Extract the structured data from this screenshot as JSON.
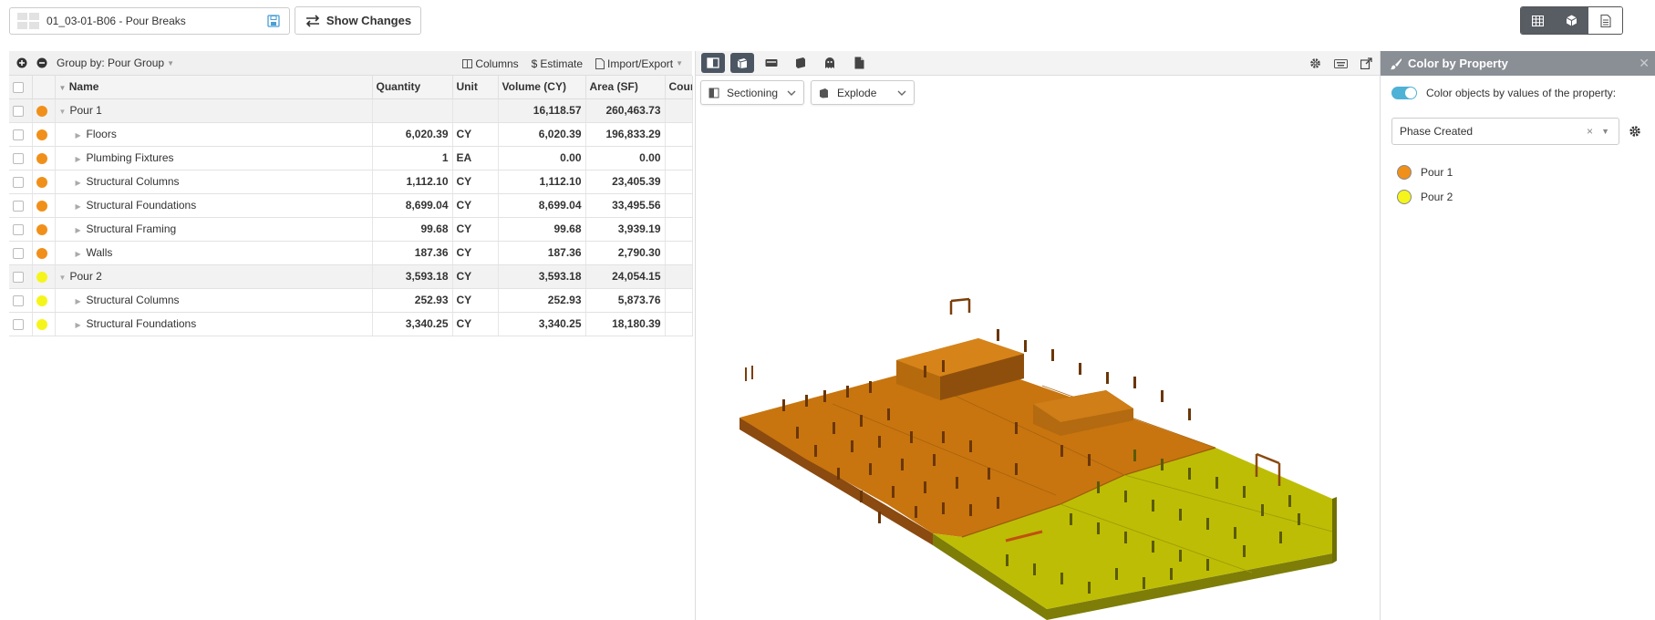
{
  "header": {
    "title": "01_03-01-B06 - Pour Breaks",
    "show_changes_label": "Show Changes"
  },
  "grid": {
    "toolbar": {
      "group_by_label": "Group by: Pour Group",
      "columns_label": "Columns",
      "estimate_label": "Estimate",
      "import_export_label": "Import/Export"
    },
    "columns": [
      "Name",
      "Quantity",
      "Unit",
      "Volume (CY)",
      "Area (SF)",
      "Cour"
    ],
    "rows": [
      {
        "type": "group",
        "color": "#f0901a",
        "name": "Pour 1",
        "quantity": "",
        "unit": "",
        "volume": "16,118.57",
        "area": "260,463.73"
      },
      {
        "type": "item",
        "color": "#f0901a",
        "name": "Floors",
        "quantity": "6,020.39",
        "unit": "CY",
        "volume": "6,020.39",
        "area": "196,833.29"
      },
      {
        "type": "item",
        "color": "#f0901a",
        "name": "Plumbing Fixtures",
        "quantity": "1",
        "unit": "EA",
        "volume": "0.00",
        "area": "0.00"
      },
      {
        "type": "item",
        "color": "#f0901a",
        "name": "Structural Columns",
        "quantity": "1,112.10",
        "unit": "CY",
        "volume": "1,112.10",
        "area": "23,405.39"
      },
      {
        "type": "item",
        "color": "#f0901a",
        "name": "Structural Foundations",
        "quantity": "8,699.04",
        "unit": "CY",
        "volume": "8,699.04",
        "area": "33,495.56"
      },
      {
        "type": "item",
        "color": "#f0901a",
        "name": "Structural Framing",
        "quantity": "99.68",
        "unit": "CY",
        "volume": "99.68",
        "area": "3,939.19"
      },
      {
        "type": "item",
        "color": "#f0901a",
        "name": "Walls",
        "quantity": "187.36",
        "unit": "CY",
        "volume": "187.36",
        "area": "2,790.30"
      },
      {
        "type": "group",
        "color": "#f5f51c",
        "name": "Pour 2",
        "quantity": "3,593.18",
        "unit": "CY",
        "volume": "3,593.18",
        "area": "24,054.15"
      },
      {
        "type": "item",
        "color": "#f5f51c",
        "name": "Structural Columns",
        "quantity": "252.93",
        "unit": "CY",
        "volume": "252.93",
        "area": "5,873.76"
      },
      {
        "type": "item",
        "color": "#f5f51c",
        "name": "Structural Foundations",
        "quantity": "3,340.25",
        "unit": "CY",
        "volume": "3,340.25",
        "area": "18,180.39"
      }
    ]
  },
  "viewer": {
    "sectioning_label": "Sectioning",
    "explode_label": "Explode"
  },
  "properties": {
    "title": "Color by Property",
    "toggle_label": "Color objects by values of the property:",
    "selected_property": "Phase Created",
    "legend": [
      {
        "label": "Pour 1",
        "color": "#f0901a"
      },
      {
        "label": "Pour 2",
        "color": "#f5f51c"
      }
    ]
  }
}
